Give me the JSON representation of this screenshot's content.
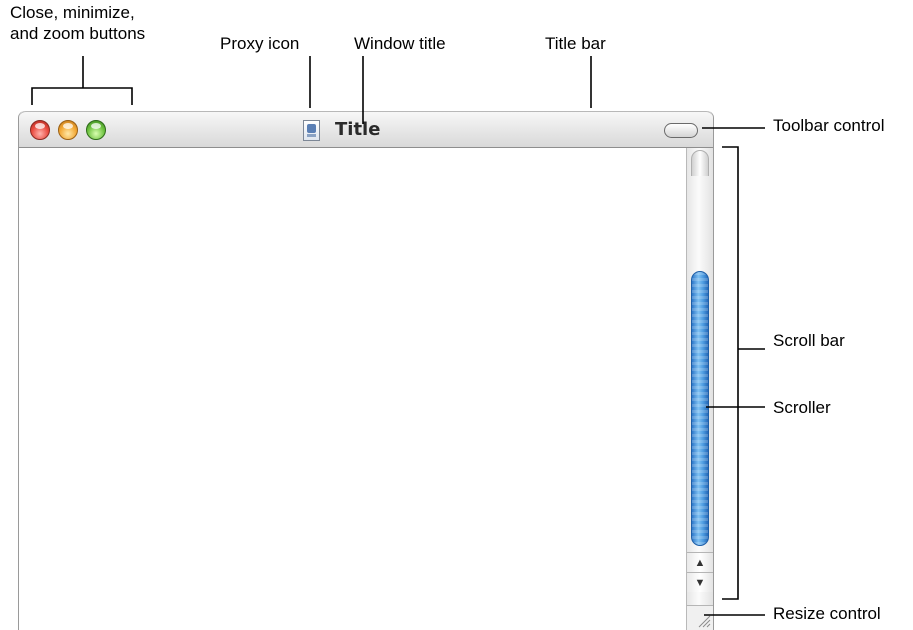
{
  "callouts": {
    "buttons_line1": "Close, minimize,",
    "buttons_line2": "and zoom buttons",
    "proxy_icon": "Proxy icon",
    "window_title": "Window title",
    "title_bar": "Title bar",
    "toolbar_control": "Toolbar control",
    "scroll_bar": "Scroll bar",
    "scroller": "Scroller",
    "resize_control": "Resize control"
  },
  "window": {
    "title": "Title",
    "proxy_icon": "document-proxy-icon",
    "traffic_lights": [
      {
        "name": "close-button",
        "color": "#e8483d"
      },
      {
        "name": "minimize-button",
        "color": "#f2a632"
      },
      {
        "name": "zoom-button",
        "color": "#6cc13e"
      }
    ],
    "scroller_color": "#4d9be0",
    "scroll_arrows": {
      "up": "▲",
      "down": "▼"
    }
  }
}
